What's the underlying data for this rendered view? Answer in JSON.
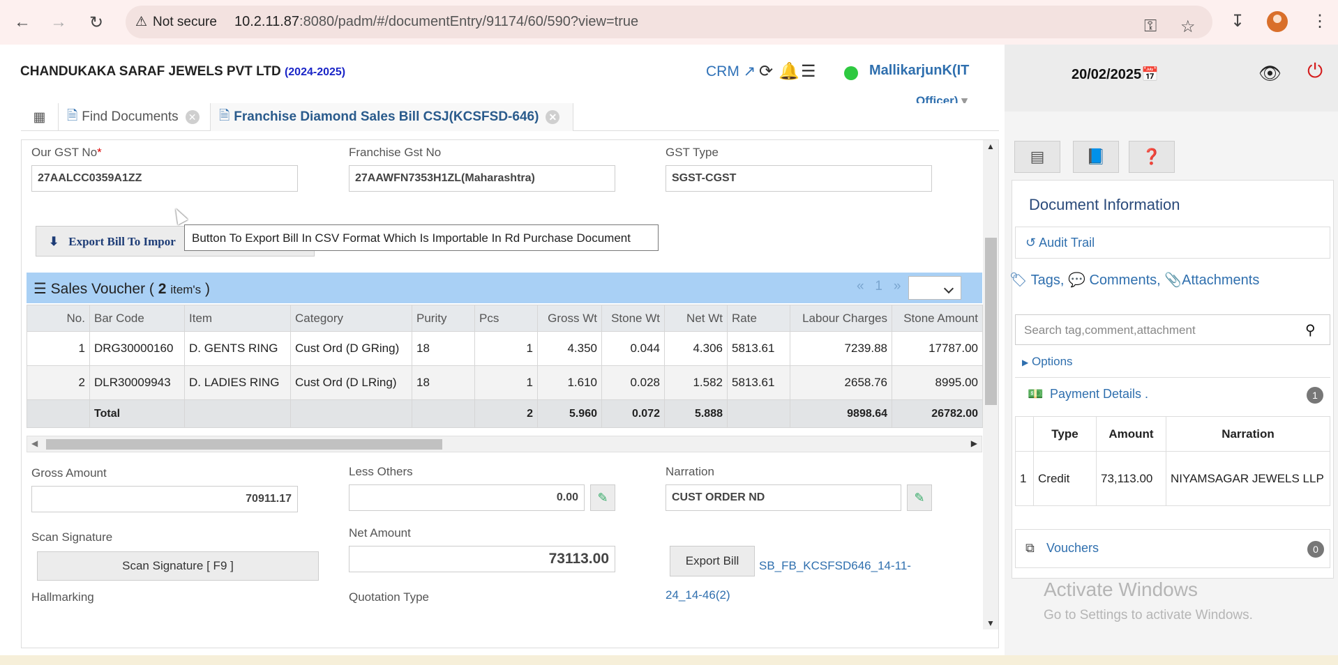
{
  "browser": {
    "security_label": "Not secure",
    "url_host": "10.2.11.87",
    "url_path": ":8080/padm/#/documentEntry/91174/60/590?view=true"
  },
  "header": {
    "company": "CHANDUKAKA SARAF JEWELS PVT LTD",
    "financial_year": "(2024-2025)",
    "crm": "CRM",
    "user_name": "MallikarjunK(IT",
    "user_role": "Officer)",
    "date": "20/02/2025"
  },
  "tabs": [
    {
      "label": "Find Documents"
    },
    {
      "label": "Franchise Diamond Sales Bill CSJ(KCSFSD-646)"
    }
  ],
  "form": {
    "our_gst_label": "Our GST No",
    "our_gst_required": "*",
    "our_gst_value": "27AALCC0359A1ZZ",
    "franchise_gst_label": "Franchise Gst No",
    "franchise_gst_value": "27AAWFN7353H1ZL(Maharashtra)",
    "gst_type_label": "GST Type",
    "gst_type_value": "SGST-CGST",
    "export_button": "Export Bill To Impor",
    "tooltip": "Button To Export Bill In CSV Format Which Is Importable In Rd Purchase Document",
    "gross_amount_label": "Gross Amount",
    "gross_amount_value": "70911.17",
    "less_others_label": "Less Others",
    "less_others_value": "0.00",
    "narration_label": "Narration",
    "narration_value": "CUST ORDER ND",
    "scan_signature_label": "Scan Signature",
    "scan_signature_button": "Scan Signature [ F9 ]",
    "net_amount_label": "Net Amount",
    "net_amount_value": "73113.00",
    "export_bill_button": "Export Bill",
    "export_bill_file": "SB_FB_KCSFSD646_14-11-24_14-46(2)",
    "hallmarking_label": "Hallmarking",
    "quotation_type_label": "Quotation Type"
  },
  "sales_voucher": {
    "title": "Sales Voucher (",
    "count": "2",
    "items_label": "item's",
    "close": ")",
    "pager_prev": "«",
    "pager_page": "1",
    "pager_next": "»",
    "columns": [
      "No.",
      "Bar Code",
      "Item",
      "Category",
      "Purity",
      "Pcs",
      "Gross Wt",
      "Stone Wt",
      "Net Wt",
      "Rate",
      "Labour Charges",
      "Stone Amount"
    ],
    "rows": [
      [
        "1",
        "DRG30000160",
        "D. GENTS RING",
        "Cust Ord (D GRing)",
        "18",
        "1",
        "4.350",
        "0.044",
        "4.306",
        "5813.61",
        "7239.88",
        "17787.00"
      ],
      [
        "2",
        "DLR30009943",
        "D. LADIES RING",
        "Cust Ord (D LRing)",
        "18",
        "1",
        "1.610",
        "0.028",
        "1.582",
        "5813.61",
        "2658.76",
        "8995.00"
      ]
    ],
    "total": [
      "",
      "Total",
      "",
      "",
      "",
      "2",
      "5.960",
      "0.072",
      "5.888",
      "",
      "9898.64",
      "26782.00"
    ]
  },
  "right_panel": {
    "doc_info_title": "Document Information",
    "audit_trail": "Audit Trail",
    "tags": "Tags,",
    "comments": "Comments,",
    "attachments": "Attachments",
    "search_placeholder": "Search tag,comment,attachment",
    "options": "Options",
    "payment_details": "Payment Details .",
    "payment_count": "1",
    "payment_columns": [
      "",
      "Type",
      "Amount",
      "Narration"
    ],
    "payment_rows": [
      [
        "1",
        "Credit",
        "73,113.00",
        "NIYAMSAGAR JEWELS LLP"
      ]
    ],
    "vouchers": "Vouchers",
    "vouchers_count": "0"
  },
  "watermark": {
    "title": "Activate Windows",
    "subtitle": "Go to Settings to activate Windows."
  },
  "colors": {
    "accent_blue": "#2f6fae",
    "voucher_header": "#a9d0f5",
    "status_online": "#2ec940",
    "power_red": "#d41c1c"
  }
}
